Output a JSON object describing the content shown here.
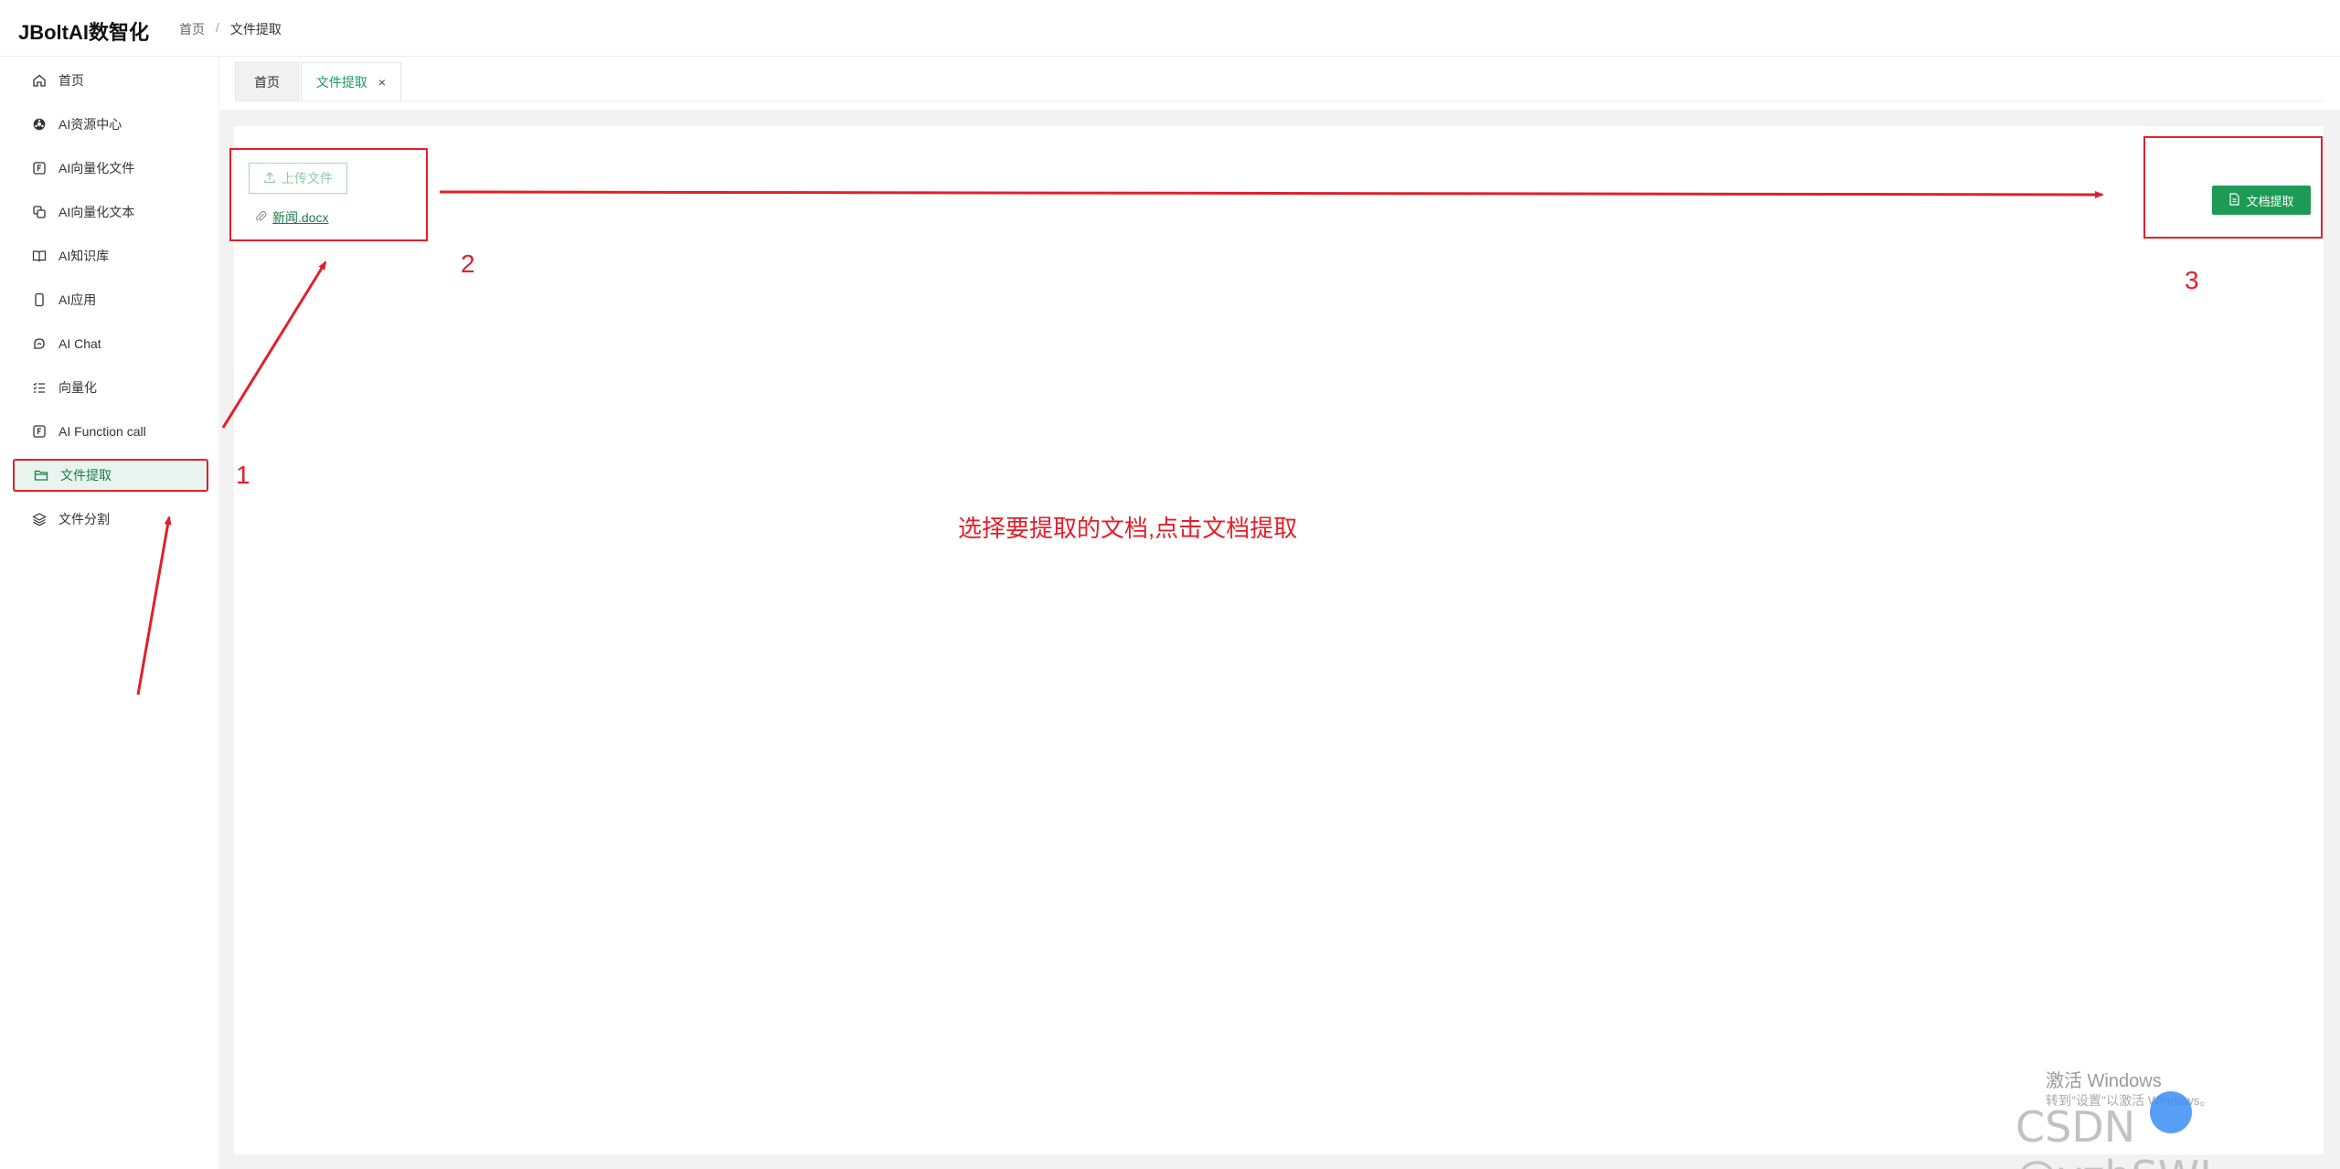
{
  "header": {
    "logo": "JBoltAI数智化",
    "breadcrumb": [
      "首页",
      "文件提取"
    ],
    "breadcrumb_sep": "/"
  },
  "sidebar": {
    "items": [
      {
        "label": "首页",
        "icon": "home-icon"
      },
      {
        "label": "AI资源中心",
        "icon": "settings-cog-icon"
      },
      {
        "label": "AI向量化文件",
        "icon": "function-box-icon"
      },
      {
        "label": "AI向量化文本",
        "icon": "copy-icon"
      },
      {
        "label": "AI知识库",
        "icon": "book-icon"
      },
      {
        "label": "AI应用",
        "icon": "phone-icon"
      },
      {
        "label": "AI Chat",
        "icon": "chat-icon"
      },
      {
        "label": "向量化",
        "icon": "list-icon"
      },
      {
        "label": "AI Function call",
        "icon": "function-box-icon"
      },
      {
        "label": "文件提取",
        "icon": "folder-icon",
        "active": true
      },
      {
        "label": "文件分割",
        "icon": "layers-icon"
      }
    ]
  },
  "tabs": [
    {
      "label": "首页"
    },
    {
      "label": "文件提取",
      "active": true,
      "close": "×"
    }
  ],
  "main": {
    "upload_label": "上传文件",
    "file_name": "新闻.docx",
    "extract_label": "文档提取"
  },
  "annotations": {
    "numbers": [
      "1",
      "2",
      "3"
    ],
    "instruction": "选择要提取的文档,点击文档提取",
    "color": "#e0202a"
  },
  "watermarks": {
    "activate_title": "激活 Windows",
    "activate_sub": "转到\"设置\"以激活 Windows。",
    "csdn": "CSDN @yzhSWJ"
  },
  "colors": {
    "accent": "#1e9a57",
    "active_bg": "#e8f5ee"
  }
}
